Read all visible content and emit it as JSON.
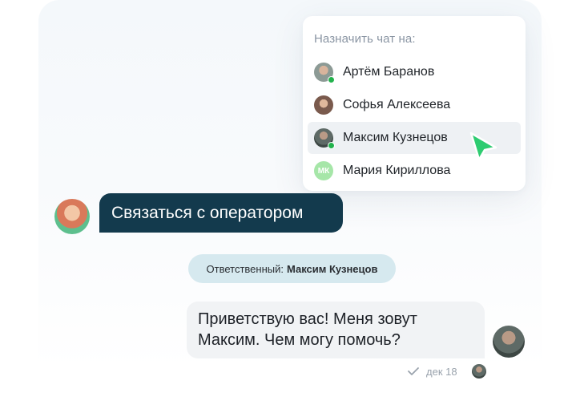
{
  "assign_menu": {
    "title": "Назначить чат на:",
    "agents": [
      {
        "name": "Артём Баранов",
        "online": true,
        "avatar_color": "#8c9a95"
      },
      {
        "name": "Софья Алексеева",
        "online": false,
        "avatar_color": "#7a5a4d"
      },
      {
        "name": "Максим Кузнецов",
        "online": true,
        "avatar_color": "#5e6a66",
        "selected": true
      },
      {
        "name": "Мария Кириллова",
        "online": false,
        "initials": "МК",
        "avatar_color": "#a6e6a8"
      }
    ]
  },
  "chat": {
    "user_message": "Связаться с оператором",
    "assignee_label": "Ответственный:",
    "assignee_name": "Максим Кузнецов",
    "operator_message_line1": "Приветствую вас! Меня зовут",
    "operator_message_line2": "Максим. Чем могу помочь?",
    "timestamp": "дек 18"
  },
  "colors": {
    "accent": "#2ecc71",
    "user_bubble": "#133a4d",
    "assignee_pill": "#d6e9ef",
    "online": "#22b24c"
  }
}
